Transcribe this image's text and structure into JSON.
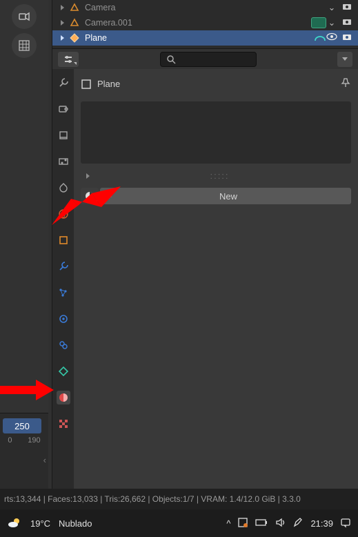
{
  "outliner": {
    "rows": [
      {
        "label": "Camera",
        "icon": "camera-icon",
        "eyeOpen": false,
        "render": true
      },
      {
        "label": "Camera.001",
        "icon": "camera-icon",
        "group": true,
        "render": true
      },
      {
        "label": "Plane",
        "icon": "mesh-icon",
        "selected": true,
        "render": true
      }
    ]
  },
  "header": {
    "search_placeholder": ""
  },
  "panel": {
    "object_name": "Plane",
    "new_button": "New"
  },
  "tabs": [
    "tool",
    "render",
    "output",
    "view-layer",
    "scene",
    "world",
    "object",
    "modifier",
    "particle",
    "physics",
    "constraint",
    "data",
    "material",
    "texture"
  ],
  "timeline": {
    "current_frame": "250",
    "tick_a": "0",
    "tick_b": "190"
  },
  "status_bar": "rts:13,344 | Faces:13,033 | Tris:26,662 | Objects:1/7 | VRAM: 1.4/12.0 GiB | 3.3.0",
  "taskbar": {
    "weather_temp": "19°C",
    "weather_desc": "Nublado",
    "time": "21:39"
  }
}
